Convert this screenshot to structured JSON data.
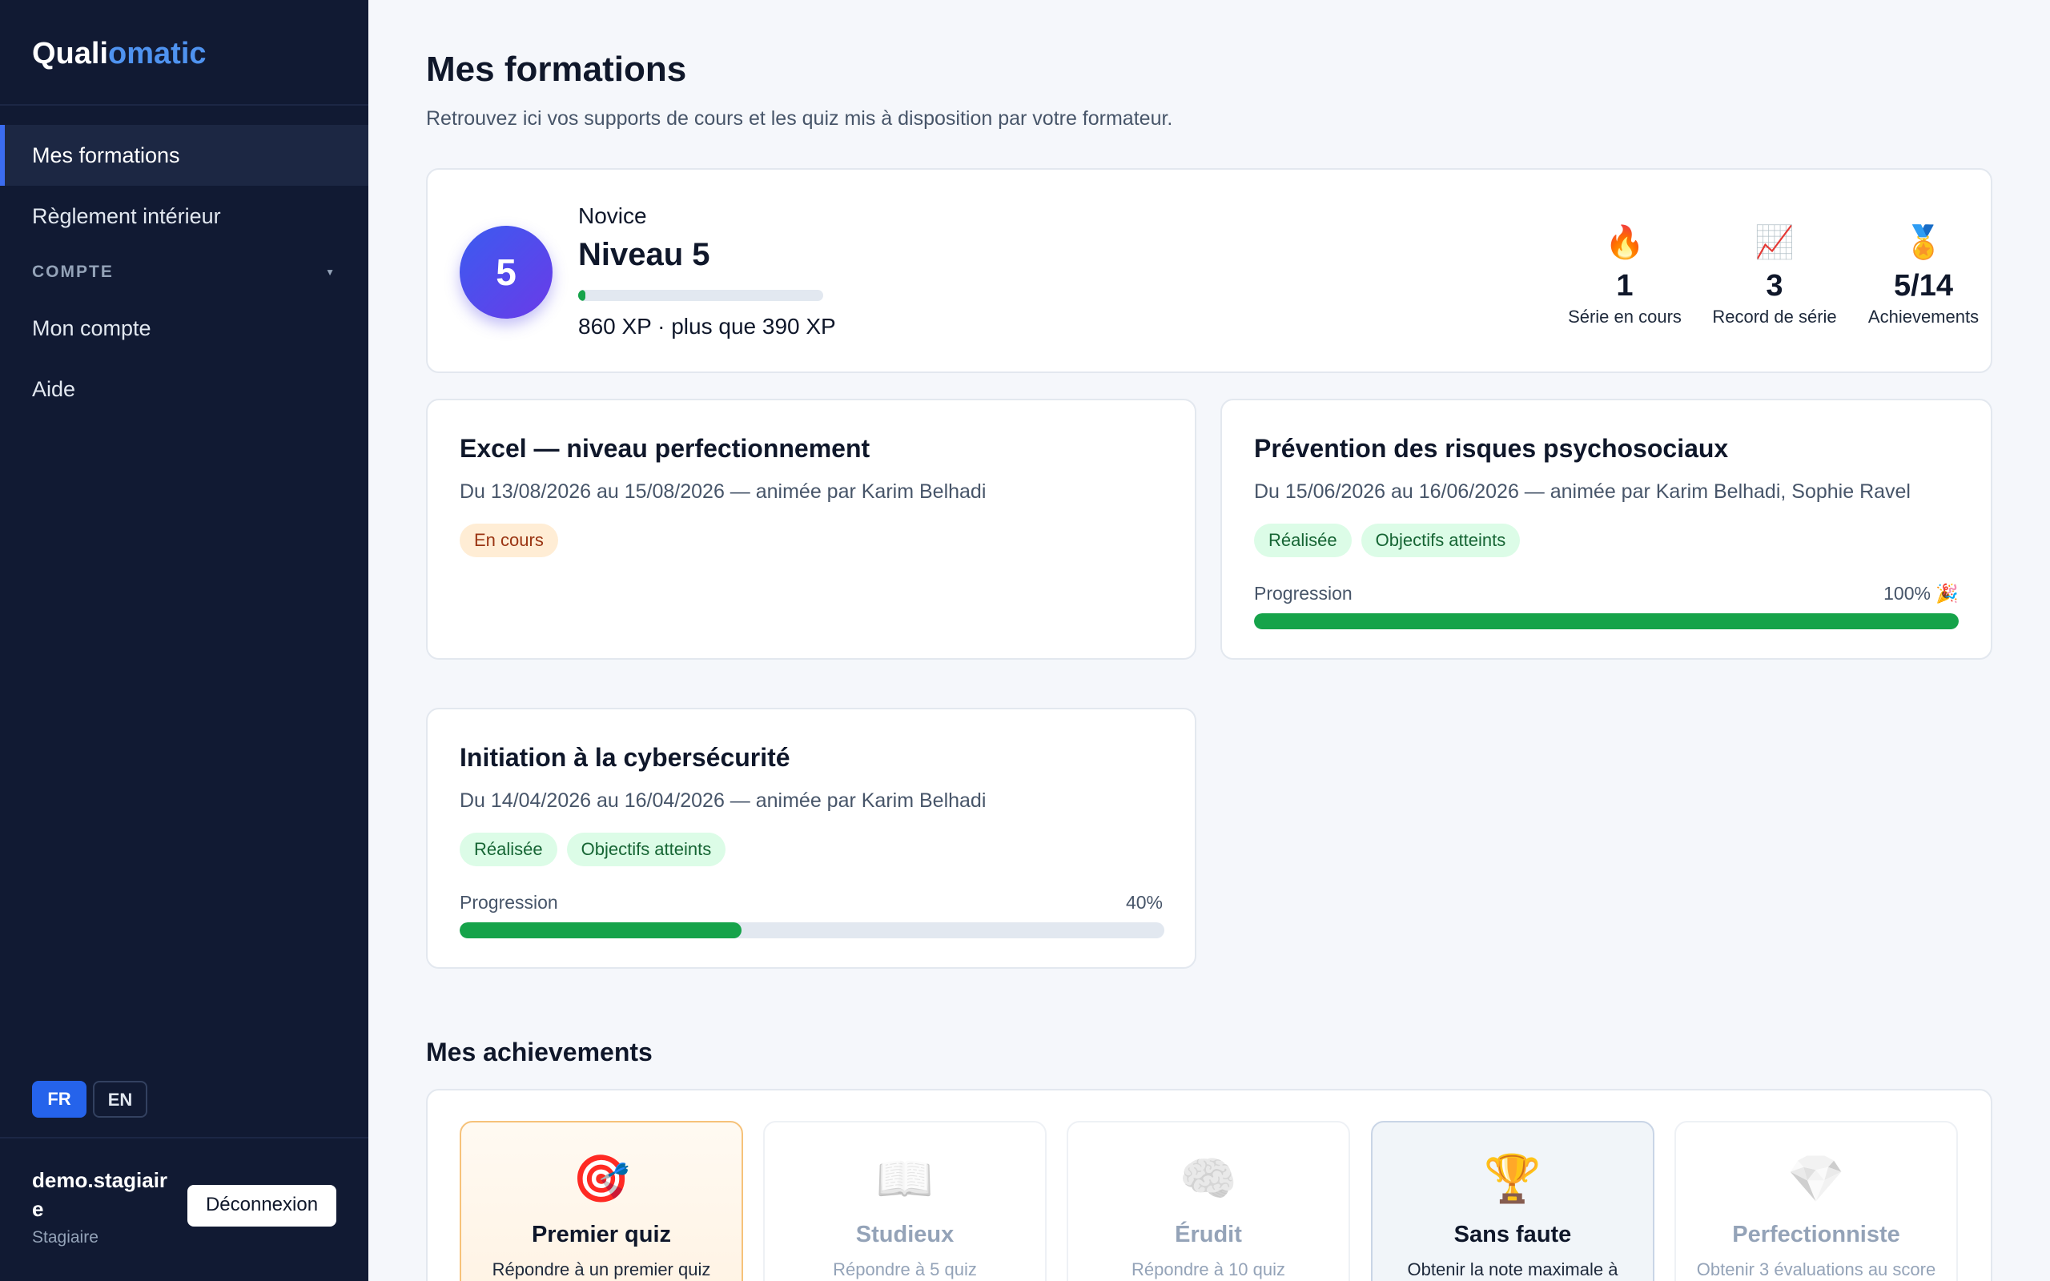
{
  "sidebar": {
    "brand_a": "Quali",
    "brand_b": "omatic",
    "items": [
      {
        "label": "Mes formations"
      },
      {
        "label": "Règlement intérieur"
      }
    ],
    "section_label": "COMPTE",
    "section_items": [
      {
        "label": "Mon compte"
      },
      {
        "label": "Aide"
      }
    ],
    "lang_fr": "FR",
    "lang_en": "EN",
    "user_name": "demo.stagiaire",
    "user_role": "Stagiaire",
    "logout_label": "Déconnexion"
  },
  "header": {
    "title": "Mes formations",
    "subtitle": "Retrouvez ici vos supports de cours et les quiz mis à disposition par votre formateur."
  },
  "level": {
    "badge": "5",
    "rank": "Novice",
    "title": "Niveau 5",
    "xp_progress_fraction": 0.03,
    "xp_text": "860 XP · plus que 390 XP",
    "stats": [
      {
        "icon": "🔥",
        "icon_name": "fire-icon",
        "value": "1",
        "label": "Série en cours"
      },
      {
        "icon": "📈",
        "icon_name": "chart-up-icon",
        "value": "3",
        "label": "Record de série"
      },
      {
        "icon": "🏅",
        "icon_name": "medal-icon",
        "value": "5/14",
        "label": "Achievements"
      }
    ]
  },
  "courses": [
    {
      "title": "Excel — niveau perfectionnement",
      "dates": "Du 13/08/2026 au 15/08/2026 — animée par Karim Belhadi",
      "badges": [
        "En cours"
      ]
    },
    {
      "title": "Prévention des risques psychosociaux",
      "dates": "Du 15/06/2026 au 16/06/2026 — animée par Karim Belhadi, Sophie Ravel",
      "badges": [
        "Réalisée",
        "Objectifs atteints"
      ],
      "progress_label": "Progression",
      "progress_value": "100% 🎉",
      "progress_fraction": 1.0
    },
    {
      "title": "Initiation à la cybersécurité",
      "dates": "Du 14/04/2026 au 16/04/2026 — animée par Karim Belhadi",
      "badges": [
        "Réalisée",
        "Objectifs atteints"
      ],
      "progress_label": "Progression",
      "progress_value": "40%",
      "progress_fraction": 0.4
    }
  ],
  "achievements_title": "Mes achievements",
  "achievements": [
    {
      "icon": "🎯",
      "icon_name": "target-icon",
      "name": "Premier quiz",
      "desc": "Répondre à un premier quiz",
      "state": "unlocked"
    },
    {
      "icon": "📖",
      "icon_name": "book-icon",
      "name": "Studieux",
      "desc": "Répondre à 5 quiz",
      "state": "locked"
    },
    {
      "icon": "🧠",
      "icon_name": "brain-icon",
      "name": "Érudit",
      "desc": "Répondre à 10 quiz",
      "state": "locked"
    },
    {
      "icon": "🏆",
      "icon_name": "trophy-icon",
      "name": "Sans faute",
      "desc": "Obtenir la note maximale à",
      "state": "unlocked"
    },
    {
      "icon": "💎",
      "icon_name": "gem-icon",
      "name": "Perfectionniste",
      "desc": "Obtenir 3 évaluations au score",
      "state": "locked"
    }
  ]
}
